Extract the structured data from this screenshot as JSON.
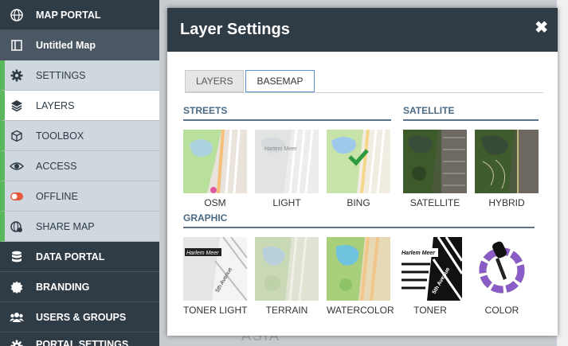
{
  "sidebar": {
    "items": [
      {
        "label": "MAP PORTAL",
        "icon": "globe-icon"
      },
      {
        "label": "Untitled Map",
        "icon": "map-book-icon"
      },
      {
        "label": "SETTINGS",
        "icon": "gear-icon"
      },
      {
        "label": "LAYERS",
        "icon": "layers-icon"
      },
      {
        "label": "TOOLBOX",
        "icon": "cube-icon"
      },
      {
        "label": "ACCESS",
        "icon": "eye-icon"
      },
      {
        "label": "OFFLINE",
        "icon": "toggle-icon"
      },
      {
        "label": "SHARE MAP",
        "icon": "share-globe-icon"
      },
      {
        "label": "DATA PORTAL",
        "icon": "database-icon"
      },
      {
        "label": "BRANDING",
        "icon": "seal-icon"
      },
      {
        "label": "USERS & GROUPS",
        "icon": "users-icon"
      },
      {
        "label": "PORTAL SETTINGS",
        "icon": "gear-icon"
      }
    ]
  },
  "map": {
    "label": "ASIA"
  },
  "dialog": {
    "title": "Layer Settings",
    "close_symbol": "✖",
    "tabs": [
      {
        "label": "LAYERS",
        "active": false
      },
      {
        "label": "BASEMAP",
        "active": true
      }
    ],
    "sections": {
      "streets": "STREETS",
      "satellite": "SATELLITE",
      "graphic": "GRAPHIC"
    },
    "basemaps": {
      "osm": {
        "label": "OSM"
      },
      "light": {
        "label": "LIGHT",
        "map_text": "Harlem Meer"
      },
      "bing": {
        "label": "BING",
        "selected": true
      },
      "satellite": {
        "label": "SATELLITE"
      },
      "hybrid": {
        "label": "HYBRID"
      },
      "toner_light": {
        "label": "TONER LIGHT",
        "map_text": "Harlem Meer",
        "street_text": "5th Avenue"
      },
      "terrain": {
        "label": "TERRAIN"
      },
      "watercolor": {
        "label": "WATERCOLOR"
      },
      "toner": {
        "label": "TONER",
        "map_text": "Harlem Meer",
        "street_text": "5th Avenue"
      },
      "color": {
        "label": "COLOR"
      }
    }
  },
  "colors": {
    "sidebar_dark": "#2f3b45",
    "sidebar_sub": "#d0d8df",
    "accent_green": "#5cb85c",
    "section_blue": "#4a6a84",
    "tab_active_border": "#5a8fd0"
  }
}
